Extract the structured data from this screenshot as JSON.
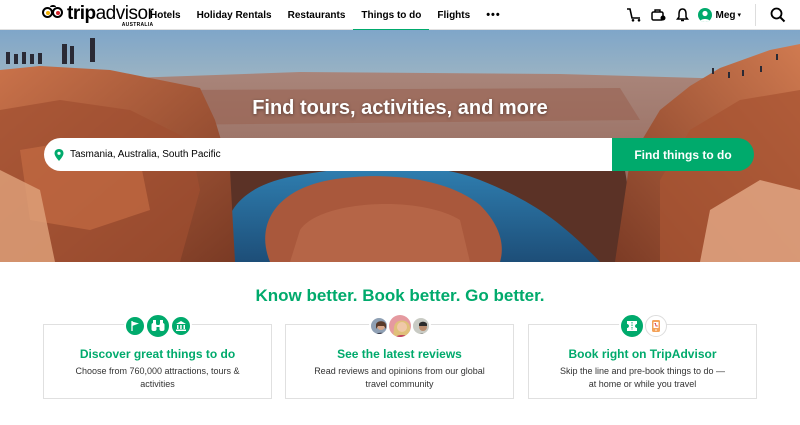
{
  "brand": {
    "logo_trip": "trip",
    "logo_advisor": "advisor",
    "logo_sub": "AUSTRALIA",
    "green": "#00aa6c"
  },
  "nav": {
    "items": [
      {
        "label": "Hotels",
        "active": false
      },
      {
        "label": "Holiday Rentals",
        "active": false
      },
      {
        "label": "Restaurants",
        "active": false
      },
      {
        "label": "Things to do",
        "active": true
      },
      {
        "label": "Flights",
        "active": false
      }
    ],
    "more": "•••"
  },
  "header_right": {
    "icons": [
      "trolley-icon",
      "trips-icon",
      "bell-icon"
    ],
    "user_name": "Meg",
    "caret": "▾",
    "search_icon": "search-icon"
  },
  "hero": {
    "title": "Find tours, activities, and more",
    "search_value": "Tasmania, Australia, South Pacific",
    "search_button": "Find things to do"
  },
  "main": {
    "tagline": "Know better. Book better. Go better.",
    "cards": [
      {
        "title": "Discover great things to do",
        "desc": "Choose from 760,000 attractions, tours & activities",
        "icons": [
          "flag-icon",
          "binoculars-icon",
          "museum-icon"
        ]
      },
      {
        "title": "See the latest reviews",
        "desc": "Read reviews and opinions from our global travel community",
        "icons": [
          "reviewer-avatar-1",
          "reviewer-avatar-2",
          "reviewer-avatar-3"
        ]
      },
      {
        "title": "Book right on TripAdvisor",
        "desc": "Skip the line and pre-book things to do — at home or while you travel",
        "icons": [
          "ticket-icon",
          "phone-cart-icon"
        ]
      }
    ]
  }
}
